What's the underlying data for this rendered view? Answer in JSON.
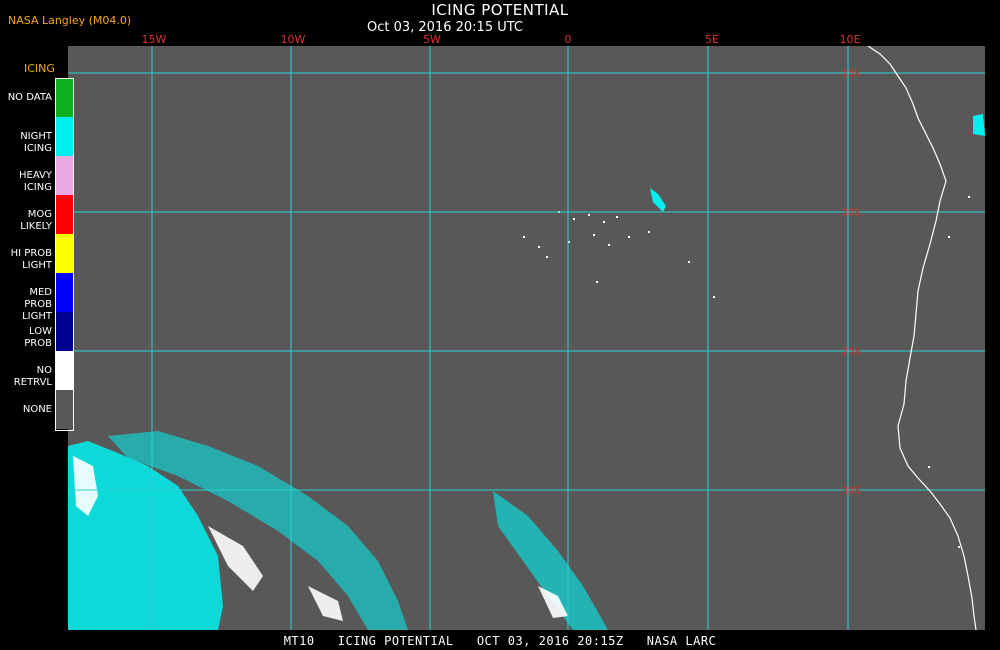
{
  "header": {
    "credit": "NASA Langley (M04.0)",
    "title": "ICING POTENTIAL",
    "subtitle": "Oct 03, 2016 20:15 UTC"
  },
  "map": {
    "background": "#585858",
    "grid_color": "#29d3d3",
    "label_color": "#e03030",
    "coast_color": "#ffffff",
    "longitude_labels": [
      "15W",
      "10W",
      "5W",
      "0",
      "5E",
      "10E"
    ],
    "latitude_labels": [
      "15S",
      "20S",
      "25S",
      "30S"
    ]
  },
  "legend": {
    "title": "ICING",
    "items": [
      {
        "label": "NO DATA",
        "color": "#0fb01f"
      },
      {
        "label": "NIGHT ICING",
        "color": "#00f0f0"
      },
      {
        "label": "HEAVY ICING",
        "color": "#e8a8e0"
      },
      {
        "label": "MOG LIKELY",
        "color": "#ff0000"
      },
      {
        "label": "HI PROB LIGHT",
        "color": "#ffff00"
      },
      {
        "label": "MED PROB LIGHT",
        "color": "#0000ff"
      },
      {
        "label": "LOW PROB",
        "color": "#000090"
      },
      {
        "label": "NO RETRVL",
        "color": "#ffffff"
      },
      {
        "label": "NONE",
        "color": "#585858"
      }
    ]
  },
  "footer": {
    "text": "MT10   ICING POTENTIAL   OCT 03, 2016 20:15Z   NASA LARC"
  }
}
